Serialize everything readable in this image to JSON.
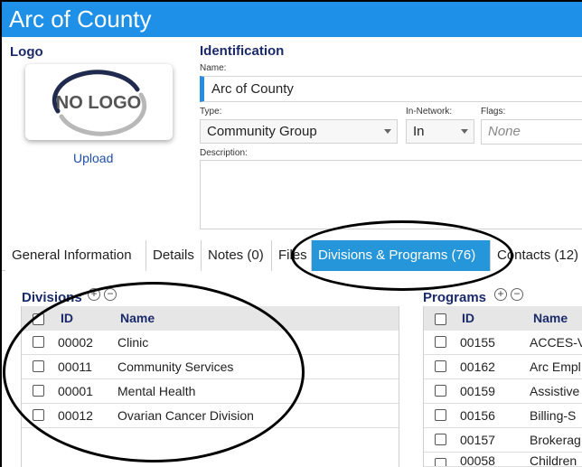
{
  "window": {
    "title": "Arc of County"
  },
  "logo": {
    "heading": "Logo",
    "placeholder_text": "NO LOGO",
    "upload_label": "Upload"
  },
  "identification": {
    "heading": "Identification",
    "name_label": "Name:",
    "name_value": "Arc of County",
    "type_label": "Type:",
    "type_value": "Community Group",
    "network_label": "In-Network:",
    "network_value": "In",
    "flags_label": "Flags:",
    "flags_placeholder": "None",
    "description_label": "Description:",
    "description_value": ""
  },
  "tabs": [
    {
      "label": "General Information"
    },
    {
      "label": "Details"
    },
    {
      "label": "Notes (0)"
    },
    {
      "label": "Files"
    },
    {
      "label": "Divisions & Programs (76)",
      "active": true
    },
    {
      "label": "Contacts (12)"
    }
  ],
  "divisions": {
    "heading": "Divisions",
    "columns": {
      "id": "ID",
      "name": "Name"
    },
    "rows": [
      {
        "id": "00002",
        "name": "Clinic"
      },
      {
        "id": "00011",
        "name": "Community Services"
      },
      {
        "id": "00001",
        "name": "Mental Health"
      },
      {
        "id": "00012",
        "name": "Ovarian Cancer Division"
      }
    ]
  },
  "programs": {
    "heading": "Programs",
    "columns": {
      "id": "ID",
      "name": "Name"
    },
    "rows": [
      {
        "id": "00155",
        "name": "ACCES-V"
      },
      {
        "id": "00162",
        "name": "Arc Empl"
      },
      {
        "id": "00159",
        "name": "Assistive"
      },
      {
        "id": "00156",
        "name": "Billing-S"
      },
      {
        "id": "00157",
        "name": "Brokerag"
      },
      {
        "id": "00058",
        "name": "Children"
      }
    ]
  },
  "colors": {
    "accent": "#2596d9",
    "titlebar": "#1e90e8",
    "heading": "#1a2a6a"
  },
  "icons": {
    "add": "plus-circle-icon",
    "remove": "minus-circle-icon"
  }
}
